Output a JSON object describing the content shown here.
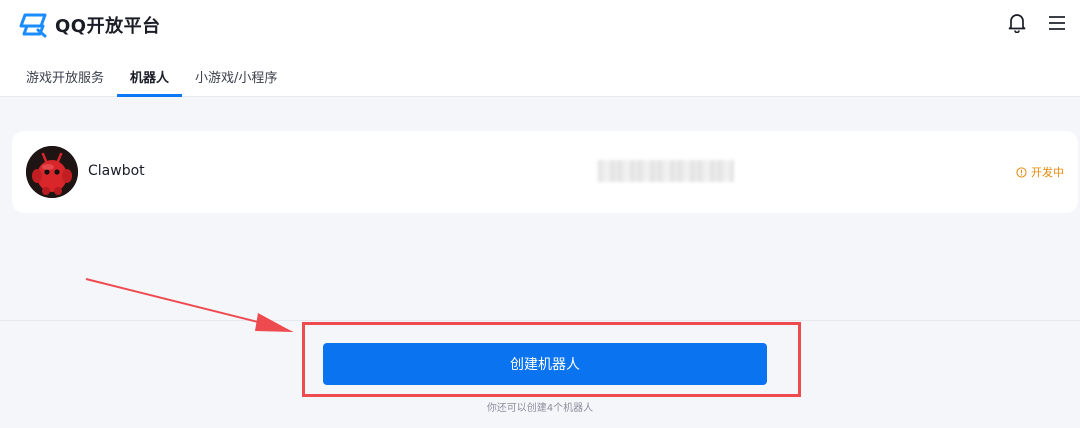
{
  "header": {
    "logo_text": "QQ开放平台",
    "icons": [
      "bell-icon",
      "menu-icon"
    ]
  },
  "tabs": [
    {
      "label": "游戏开放服务",
      "active": false
    },
    {
      "label": "机器人",
      "active": true
    },
    {
      "label": "小游戏/小程序",
      "active": false
    }
  ],
  "bot": {
    "name": "Clawbot",
    "status": "开发中",
    "status_color": "#e58b0c"
  },
  "create": {
    "button_label": "创建机器人",
    "hint": "你还可以创建4个机器人"
  },
  "colors": {
    "accent": "#0a73f0",
    "annotation": "#ee4b4f"
  }
}
